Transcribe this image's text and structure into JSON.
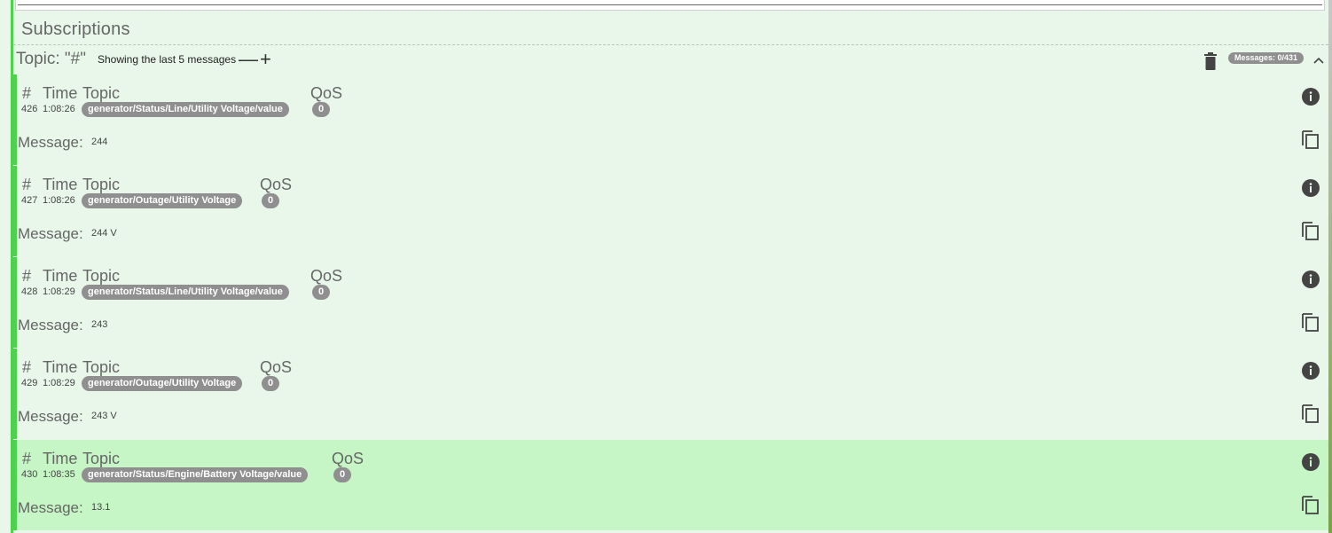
{
  "subscriptions_title": "Subscriptions",
  "topic": {
    "label": "Topic: \"#\"",
    "showing_text": "Showing the last 5 messages",
    "minus_label": "—",
    "plus_label": "+",
    "messages_badge": "Messages: 0/431"
  },
  "columns": {
    "hash": "#",
    "time": "Time",
    "topic": "Topic",
    "qos": "QoS",
    "message": "Message:"
  },
  "messages": [
    {
      "num": "426",
      "time": "1:08:26",
      "topic": "generator/Status/Line/Utility Voltage/value",
      "qos": "0",
      "value": "244"
    },
    {
      "num": "427",
      "time": "1:08:26",
      "topic": "generator/Outage/Utility Voltage",
      "qos": "0",
      "value": "244 V"
    },
    {
      "num": "428",
      "time": "1:08:29",
      "topic": "generator/Status/Line/Utility Voltage/value",
      "qos": "0",
      "value": "243"
    },
    {
      "num": "429",
      "time": "1:08:29",
      "topic": "generator/Outage/Utility Voltage",
      "qos": "0",
      "value": "243 V"
    },
    {
      "num": "430",
      "time": "1:08:35",
      "topic": "generator/Status/Engine/Battery Voltage/value",
      "qos": "0",
      "value": "13.1"
    }
  ],
  "icons": {
    "trash": "trash-icon",
    "collapse": "chevron-up-icon",
    "info": "info-icon",
    "copy": "copy-icon"
  },
  "colors": {
    "background": "#e8f7ea",
    "accent": "#4cd24c",
    "highlight": "#c6f6c6",
    "chip": "#8f8f8f"
  }
}
